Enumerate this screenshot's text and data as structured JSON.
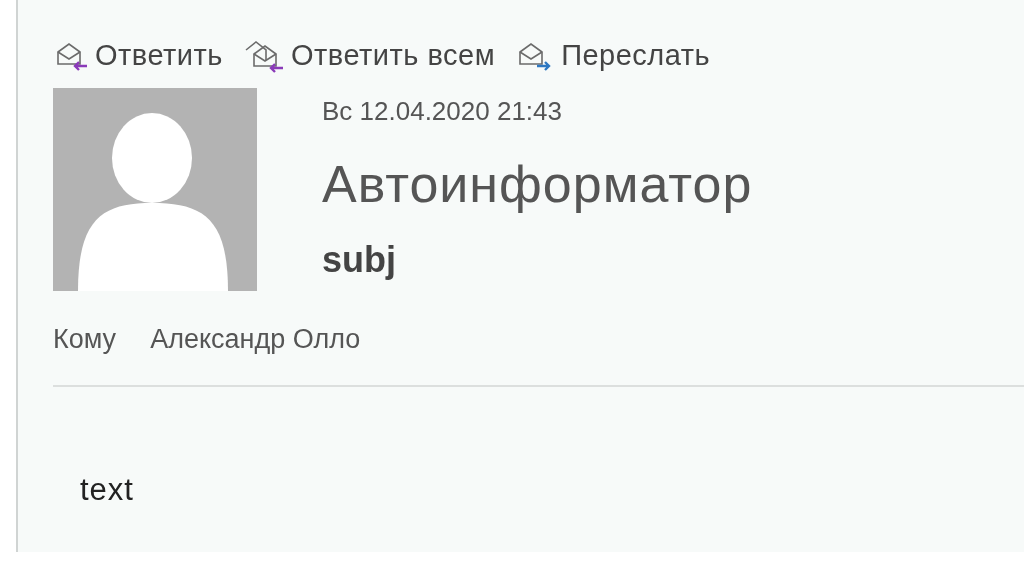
{
  "toolbar": {
    "buttons": [
      {
        "kind": "reply",
        "label": "Ответить"
      },
      {
        "kind": "reply_all",
        "label": "Ответить всем"
      },
      {
        "kind": "forward",
        "label": "Переслать"
      }
    ]
  },
  "message": {
    "date": "Вс 12.04.2020 21:43",
    "sender": "Автоинформатор",
    "subject": "subj",
    "to_label": "Кому",
    "to": "Александр Олло",
    "body": "text"
  }
}
